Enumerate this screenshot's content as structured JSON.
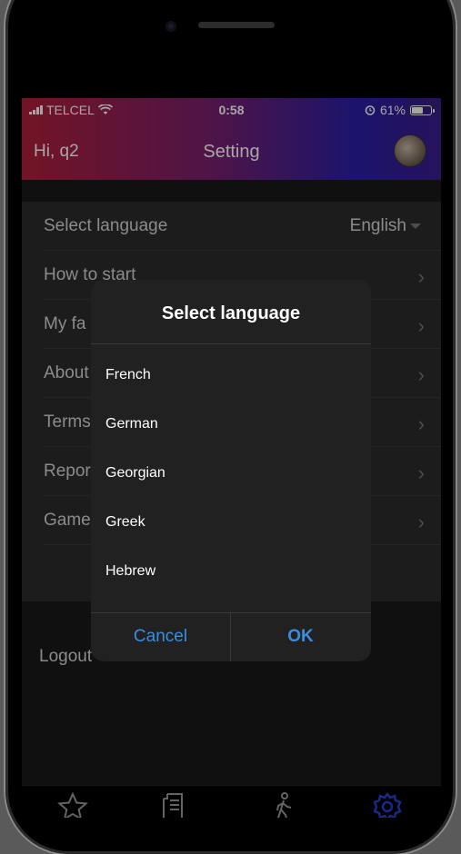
{
  "status": {
    "carrier": "TELCEL",
    "time": "0:58",
    "battery": "61%",
    "battery_level": 0.61
  },
  "header": {
    "greeting": "Hi, q2",
    "title": "Setting"
  },
  "settings": {
    "language_label": "Select language",
    "language_value": "English",
    "items": [
      "How to start",
      "My fa",
      "About",
      "Terms",
      "Repor",
      "Game"
    ],
    "logout": "Logout"
  },
  "dialog": {
    "title": "Select language",
    "options": [
      "French",
      "German",
      "Georgian",
      "Greek",
      "Hebrew"
    ],
    "cancel": "Cancel",
    "ok": "OK"
  },
  "tabs": [
    {
      "icon": "star-icon",
      "active": false
    },
    {
      "icon": "document-icon",
      "active": false
    },
    {
      "icon": "walking-icon",
      "active": false
    },
    {
      "icon": "gear-icon",
      "active": true
    }
  ],
  "colors": {
    "accent": "#3b8de0",
    "active_tab": "#2a3fd8"
  }
}
